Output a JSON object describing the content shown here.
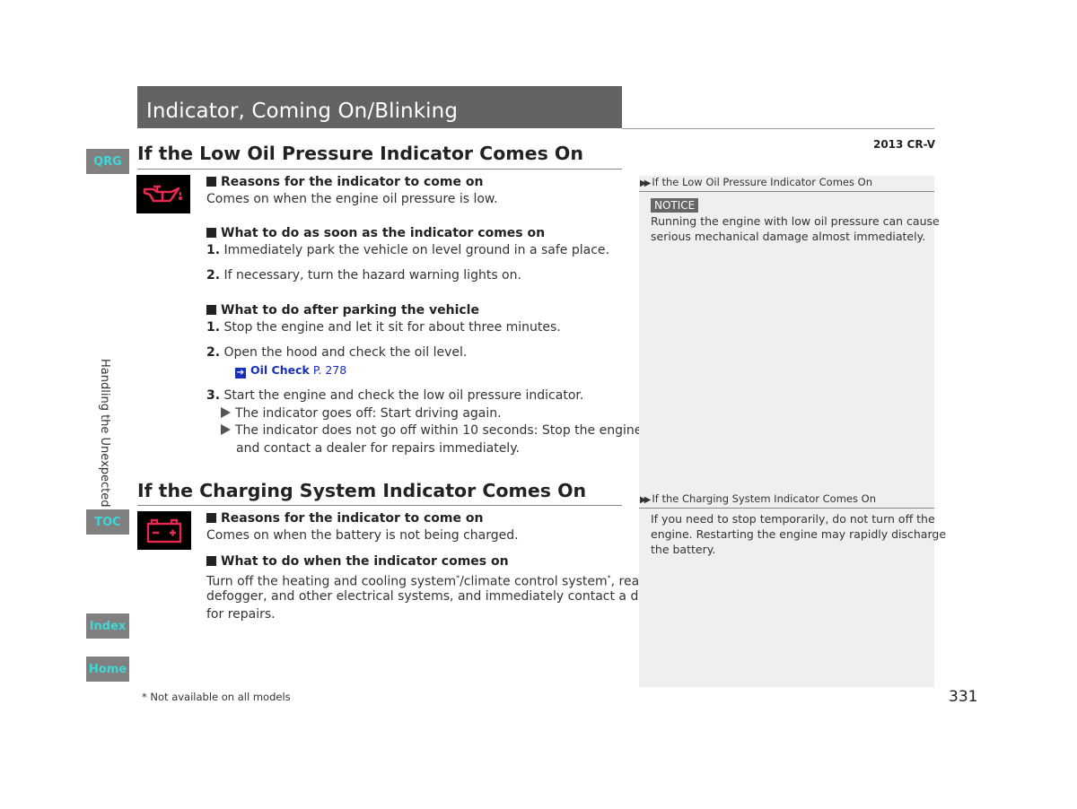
{
  "header": {
    "chapter_title": "Indicator, Coming On/Blinking",
    "model": "2013 CR-V"
  },
  "nav": {
    "qrg": "QRG",
    "toc": "TOC",
    "index": "Index",
    "home": "Home",
    "section_label": "Handling the Unexpected",
    "accent_color": "#3fd7d7"
  },
  "oil": {
    "title": "If the Low Oil Pressure Indicator Comes On",
    "icon": "oil-pressure-icon",
    "reasons_heading": "Reasons for the indicator to come on",
    "reasons_text": "Comes on when the engine oil pressure is low.",
    "asap_heading": "What to do as soon as the indicator comes on",
    "asap_steps": [
      {
        "num": "1.",
        "text": "Immediately park the vehicle on level ground in a safe place."
      },
      {
        "num": "2.",
        "text": "If necessary, turn the hazard warning lights on."
      }
    ],
    "after_heading": "What to do after parking the vehicle",
    "after_steps": [
      {
        "num": "1.",
        "text": "Stop the engine and let it sit for about three minutes."
      },
      {
        "num": "2.",
        "text": "Open the hood and check the oil level."
      },
      {
        "num": "3.",
        "text": "Start the engine and check the low oil pressure indicator."
      }
    ],
    "link_label": "Oil Check",
    "link_page": "P. 278",
    "results": [
      "The indicator goes off: Start driving again.",
      "The indicator does not go off within 10 seconds: Stop the engine",
      "and contact a dealer for repairs immediately."
    ]
  },
  "charging": {
    "title": "If the Charging System Indicator Comes On",
    "icon": "battery-icon",
    "reasons_heading": "Reasons for the indicator to come on",
    "reasons_text": "Comes on when the battery is not being charged.",
    "todo_heading": "What to do when the indicator comes on",
    "todo_lines": [
      "Turn off the heating and cooling system",
      "/climate control system",
      ", rear",
      "defogger, and other electrical systems, and immediately contact a dealer",
      "for repairs."
    ],
    "asterisk": "*"
  },
  "side_notes": {
    "oil_head": "If the Low Oil Pressure Indicator Comes On",
    "notice_label": "NOTICE",
    "oil_lines": [
      "Running the engine with low oil pressure can cause",
      "serious mechanical damage almost immediately."
    ],
    "charging_head": "If the Charging System Indicator Comes On",
    "charging_lines": [
      "If you need to stop temporarily, do not turn off the",
      "engine. Restarting the engine may rapidly discharge",
      "the battery."
    ]
  },
  "footer": {
    "footnote": "* Not available on all models",
    "page_number": "331"
  },
  "colors": {
    "indicator_red": "#e8294f",
    "link_blue": "#1a2fb8"
  }
}
